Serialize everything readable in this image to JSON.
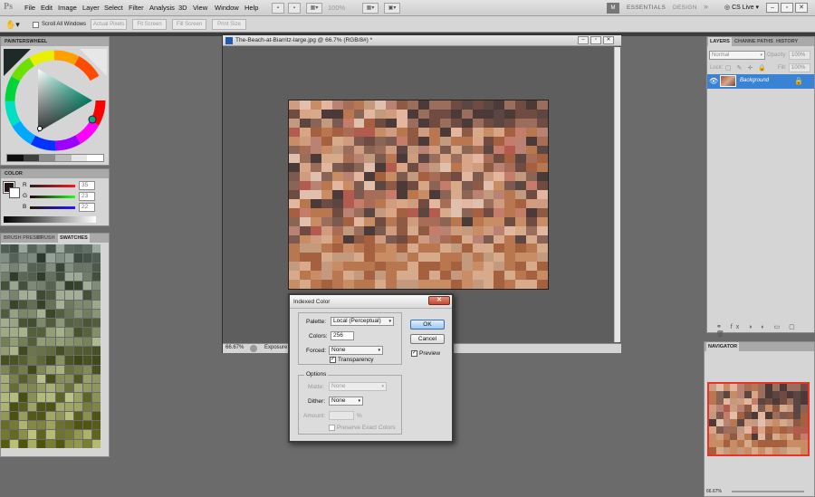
{
  "menubar": {
    "logo": "Ps",
    "items": [
      "File",
      "Edit",
      "Image",
      "Layer",
      "Select",
      "Filter",
      "Analysis",
      "3D",
      "View",
      "Window",
      "Help"
    ],
    "zoom": "100%",
    "workspaces": [
      "ESSENTIALS",
      "DESIGN",
      "»"
    ],
    "cslive": "CS Live"
  },
  "options_bar": {
    "scroll_all": "Scroll All Windows",
    "buttons": [
      "Actual Pixels",
      "Fit Screen",
      "Fill Screen",
      "Print Size"
    ]
  },
  "panels": {
    "painterswheel": "PAINTERSWHEEL",
    "color": {
      "title": "COLOR",
      "r": "35",
      "g": "23",
      "b": "22"
    },
    "brush_tabs": [
      "BRUSH PRESET",
      "BRUSH",
      "SWATCHES"
    ],
    "layers": {
      "tabs": [
        "LAYERS",
        "CHANNE",
        "PATHS",
        "HISTORY"
      ],
      "blend": "Normal",
      "opacity_label": "Opacity:",
      "opacity": "100%",
      "lock_label": "Lock:",
      "fill_label": "Fill:",
      "fill": "100%",
      "layer_name": "Background"
    },
    "navigator": {
      "title": "NAVIGATOR",
      "zoom": "66.67%"
    }
  },
  "document": {
    "title": "The-Beach-at-Biarritz-large.jpg @ 66.7% (RGB/8#) *",
    "zoom": "66.67%",
    "status": "Exposure works in 32-bit only"
  },
  "dialog": {
    "title": "Indexed Color",
    "palette_label": "Palette:",
    "palette_value": "Local (Perceptual)",
    "colors_label": "Colors:",
    "colors_value": "256",
    "forced_label": "Forced:",
    "forced_value": "None",
    "transparency_label": "Transparency",
    "options_label": "Options",
    "matte_label": "Matte:",
    "matte_value": "None",
    "dither_label": "Dither:",
    "dither_value": "None",
    "amount_label": "Amount:",
    "amount_unit": "%",
    "preserve_label": "Preserve Exact Colors",
    "ok": "OK",
    "cancel": "Cancel",
    "preview_label": "Preview"
  },
  "colors": {
    "accent": "#4f8fd6",
    "selection": "#3a82d4"
  }
}
